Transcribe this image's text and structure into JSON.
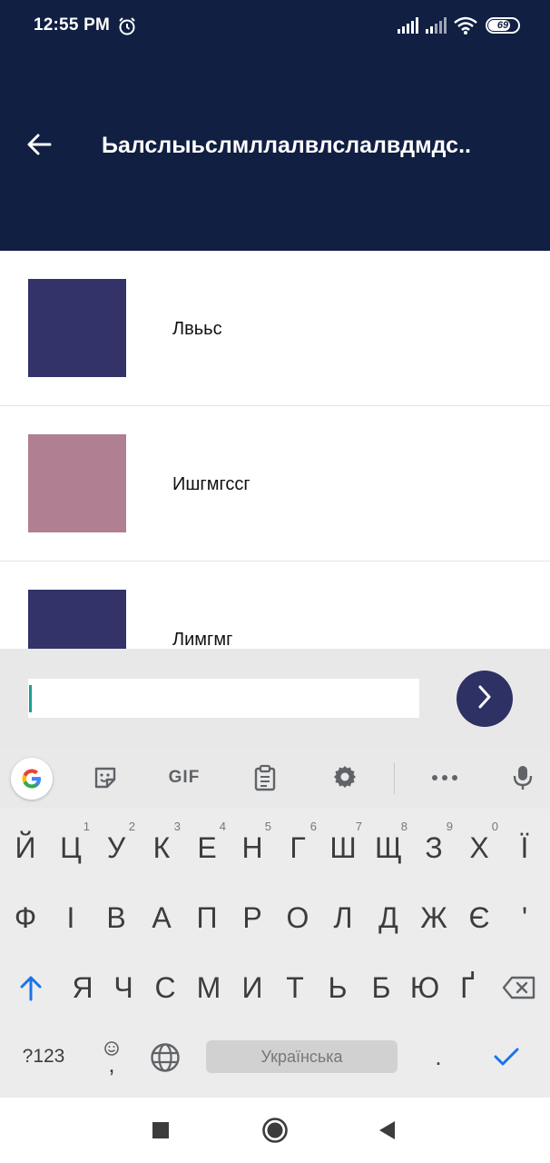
{
  "status_bar": {
    "time": "12:55 PM",
    "battery": "69",
    "icons": [
      "alarm-icon",
      "cell-signal-icon",
      "cell-signal-icon",
      "wifi-icon",
      "battery-icon"
    ]
  },
  "app_bar": {
    "back_icon": "arrow-back-icon",
    "title": "Ьалслыьслмллалвлслалвдмдс.."
  },
  "list": {
    "items": [
      {
        "label": "Лвььс",
        "color": "#33336a"
      },
      {
        "label": "Ишгмгссг",
        "color": "#b07f92"
      },
      {
        "label": "Лимгмг",
        "color": "#33336a"
      }
    ]
  },
  "input": {
    "value": "",
    "placeholder": "",
    "send_icon": "chevron-right-icon",
    "send_color": "#2e3163"
  },
  "keyboard": {
    "toolbar": {
      "google": "G",
      "sticker_icon": "sticker-icon",
      "gif": "GIF",
      "clipboard_icon": "clipboard-icon",
      "settings_icon": "gear-icon",
      "more_icon": "more-horizontal-icon",
      "mic_icon": "microphone-icon"
    },
    "row1": [
      "Й",
      "Ц",
      "У",
      "К",
      "Е",
      "Н",
      "Г",
      "Ш",
      "Щ",
      "З",
      "Х",
      "Ї"
    ],
    "row1_hints": [
      "",
      "1",
      "2",
      "3",
      "4",
      "5",
      "6",
      "7",
      "8",
      "9",
      "0",
      ""
    ],
    "row2": [
      "Ф",
      "І",
      "В",
      "А",
      "П",
      "Р",
      "О",
      "Л",
      "Д",
      "Ж",
      "Є",
      "'"
    ],
    "row3": [
      "Я",
      "Ч",
      "С",
      "М",
      "И",
      "Т",
      "Ь",
      "Б",
      "Ю",
      "Ґ"
    ],
    "shift_icon": "arrow-up-icon",
    "backspace_icon": "backspace-icon",
    "symbols_label": "?123",
    "emoji_comma": ",",
    "globe_icon": "globe-icon",
    "space_label": "Українська",
    "period": ".",
    "enter_icon": "checkmark-icon",
    "accent_color": "#1a73e8"
  },
  "nav_bar": {
    "recents_icon": "square-icon",
    "home_icon": "circle-icon",
    "back_icon": "triangle-back-icon"
  }
}
